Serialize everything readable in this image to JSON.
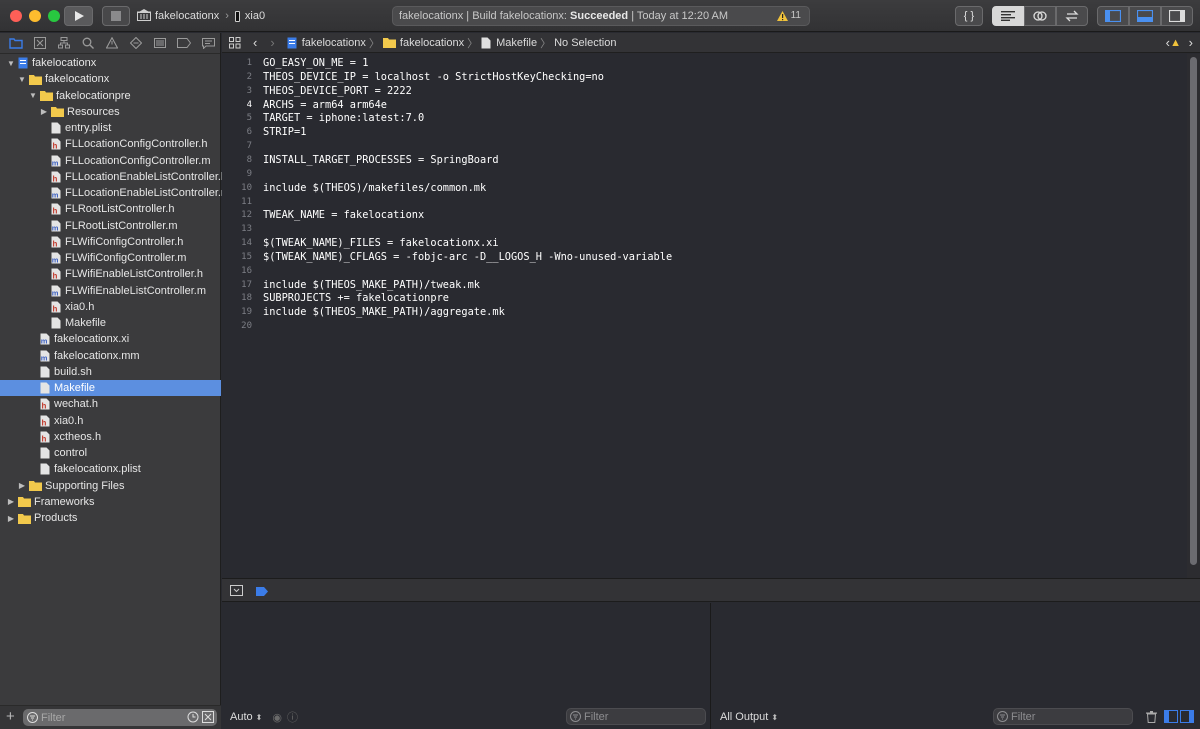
{
  "toolbar": {
    "scheme_name": "fakelocationx",
    "destination": "xia0",
    "activity_project": "fakelocationx",
    "activity_separator": " | ",
    "activity_prefix": "Build fakelocationx: ",
    "activity_status": "Succeeded",
    "activity_time": " | Today at 12:20 AM",
    "warning_count": "11",
    "library_label": "{ }"
  },
  "navigator": {
    "tree": [
      {
        "label": "fakelocationx",
        "depth": 0,
        "disclosure": "open",
        "icon": "project-icon"
      },
      {
        "label": "fakelocationx",
        "depth": 1,
        "disclosure": "open",
        "icon": "folder-icon"
      },
      {
        "label": "fakelocationpre",
        "depth": 2,
        "disclosure": "open",
        "icon": "folder-icon"
      },
      {
        "label": "Resources",
        "depth": 3,
        "disclosure": "closed",
        "icon": "folder-icon"
      },
      {
        "label": "entry.plist",
        "depth": 3,
        "icon": "file-icon"
      },
      {
        "label": "FLLocationConfigController.h",
        "depth": 3,
        "icon": "header-file-icon"
      },
      {
        "label": "FLLocationConfigController.m",
        "depth": 3,
        "icon": "source-file-icon"
      },
      {
        "label": "FLLocationEnableListController.h",
        "depth": 3,
        "icon": "header-file-icon"
      },
      {
        "label": "FLLocationEnableListController.m",
        "depth": 3,
        "icon": "source-file-icon"
      },
      {
        "label": "FLRootListController.h",
        "depth": 3,
        "icon": "header-file-icon"
      },
      {
        "label": "FLRootListController.m",
        "depth": 3,
        "icon": "source-file-icon"
      },
      {
        "label": "FLWifiConfigController.h",
        "depth": 3,
        "icon": "header-file-icon"
      },
      {
        "label": "FLWifiConfigController.m",
        "depth": 3,
        "icon": "source-file-icon"
      },
      {
        "label": "FLWifiEnableListController.h",
        "depth": 3,
        "icon": "header-file-icon"
      },
      {
        "label": "FLWifiEnableListController.m",
        "depth": 3,
        "icon": "source-file-icon"
      },
      {
        "label": "xia0.h",
        "depth": 3,
        "icon": "header-file-icon"
      },
      {
        "label": "Makefile",
        "depth": 3,
        "icon": "file-icon"
      },
      {
        "label": "fakelocationx.xi",
        "depth": 2,
        "icon": "source-file-icon"
      },
      {
        "label": "fakelocationx.mm",
        "depth": 2,
        "icon": "source-file-icon"
      },
      {
        "label": "build.sh",
        "depth": 2,
        "icon": "file-icon"
      },
      {
        "label": "Makefile",
        "depth": 2,
        "icon": "file-icon",
        "selected": true
      },
      {
        "label": "wechat.h",
        "depth": 2,
        "icon": "header-file-icon"
      },
      {
        "label": "xia0.h",
        "depth": 2,
        "icon": "header-file-icon"
      },
      {
        "label": "xctheos.h",
        "depth": 2,
        "icon": "header-file-icon"
      },
      {
        "label": "control",
        "depth": 2,
        "icon": "file-icon"
      },
      {
        "label": "fakelocationx.plist",
        "depth": 2,
        "icon": "file-icon"
      },
      {
        "label": "Supporting Files",
        "depth": 1,
        "disclosure": "closed",
        "icon": "folder-icon"
      },
      {
        "label": "Frameworks",
        "depth": 0,
        "disclosure": "closed",
        "icon": "folder-icon"
      },
      {
        "label": "Products",
        "depth": 0,
        "disclosure": "closed",
        "icon": "folder-icon"
      }
    ],
    "filter_placeholder": "Filter"
  },
  "jumpbar": {
    "crumbs": [
      "fakelocationx",
      "fakelocationx",
      "Makefile",
      "No Selection"
    ]
  },
  "editor": {
    "current_line": 4,
    "lines": [
      "GO_EASY_ON_ME = 1",
      "THEOS_DEVICE_IP = localhost -o StrictHostKeyChecking=no",
      "THEOS_DEVICE_PORT = 2222",
      "ARCHS = arm64 arm64e",
      "TARGET = iphone:latest:7.0",
      "STRIP=1",
      "",
      "INSTALL_TARGET_PROCESSES = SpringBoard",
      "",
      "include $(THEOS)/makefiles/common.mk",
      "",
      "TWEAK_NAME = fakelocationx",
      "",
      "$(TWEAK_NAME)_FILES = fakelocationx.xi",
      "$(TWEAK_NAME)_CFLAGS = -fobjc-arc -D__LOGOS_H -Wno-unused-variable",
      "",
      "include $(THEOS_MAKE_PATH)/tweak.mk",
      "SUBPROJECTS += fakelocationpre",
      "include $(THEOS_MAKE_PATH)/aggregate.mk",
      ""
    ]
  },
  "debug": {
    "variables_mode": "Auto",
    "variables_filter_placeholder": "Filter",
    "console_mode": "All Output",
    "console_filter_placeholder": "Filter"
  },
  "colors": {
    "accent": "#3b7ce8",
    "selection": "#5c8fe0",
    "folder": "#f2c94c",
    "warning": "#f0c23b"
  }
}
